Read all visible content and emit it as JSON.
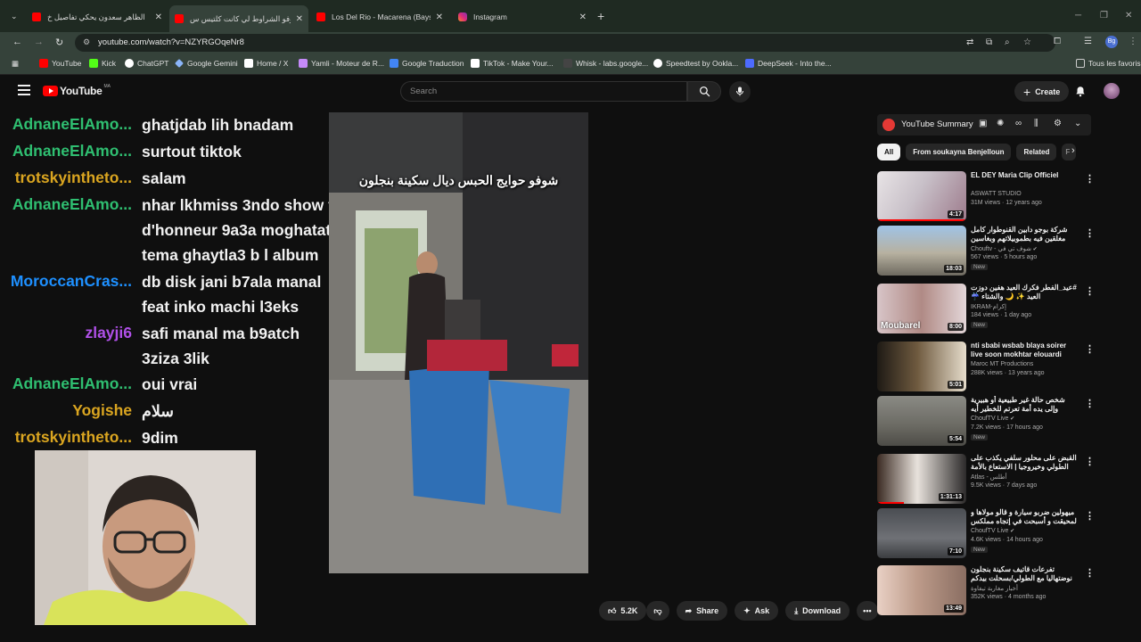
{
  "browser": {
    "tabs": [
      {
        "title": "الظاهر سعدون يحكي تفاصيل خ",
        "icon": "youtube-favicon"
      },
      {
        "title": "شوفو الشراوط لي كانت كلتيس س",
        "icon": "youtube-favicon"
      },
      {
        "title": "Los Del Rio - Macarena (Baysid",
        "icon": "youtube-favicon"
      },
      {
        "title": "Instagram",
        "icon": "instagram-favicon"
      }
    ],
    "url": "youtube.com/watch?v=NZYRGOqeNr8",
    "profile_initials": "Bg",
    "bookmarks": [
      {
        "label": "YouTube",
        "color": "#ff0000"
      },
      {
        "label": "Kick",
        "color": "#53fc18"
      },
      {
        "label": "ChatGPT",
        "color": "#ffffff"
      },
      {
        "label": "Google Gemini",
        "color": "#8ab4f8"
      },
      {
        "label": "Home / X",
        "color": "#ffffff"
      },
      {
        "label": "Yamli - Moteur de R...",
        "color": "#c58af9"
      },
      {
        "label": "Google Traduction",
        "color": "#4285f4"
      },
      {
        "label": "TikTok - Make Your...",
        "color": "#ffffff"
      },
      {
        "label": "Whisk - labs.google...",
        "color": "#444444"
      },
      {
        "label": "Speedtest by Ookla...",
        "color": "#ffffff"
      },
      {
        "label": "DeepSeek - Into the...",
        "color": "#4d6bfe"
      }
    ],
    "all_bookmarks_label": "Tous les favoris"
  },
  "youtube": {
    "logo_text": "YouTube",
    "logo_country": "MA",
    "search_placeholder": "Search",
    "create_label": "Create"
  },
  "chat": [
    {
      "user": "AdnaneElAmo...",
      "color": "#2fbf71",
      "text": "ghatjdab lih bnadam"
    },
    {
      "user": "AdnaneElAmo...",
      "color": "#2fbf71",
      "text": "surtout tiktok"
    },
    {
      "user": "trotskyintheto...",
      "color": "#daa520",
      "text": "salam"
    },
    {
      "user": "AdnaneElAmo...",
      "color": "#2fbf71",
      "text": "nhar lkhmiss 3ndo show f d'honneur 9a3a moghatat tema ghaytla3 b l album"
    },
    {
      "user": "MoroccanCras...",
      "color": "#1e90ff",
      "text": "db disk jani b7ala manal feat inko machi l3eks"
    },
    {
      "user": "zlayji6",
      "color": "#b050e8",
      "text": "safi manal ma b9atch 3ziza 3lik"
    },
    {
      "user": "AdnaneElAmo...",
      "color": "#2fbf71",
      "text": "oui vrai"
    },
    {
      "user": "Yogishe",
      "color": "#daa520",
      "text": "سلام"
    },
    {
      "user": "trotskyintheto...",
      "color": "#daa520",
      "text": "9dim"
    }
  ],
  "video": {
    "caption": "شوفو حوايج الحبس ديال سكينة بنجلون"
  },
  "actions": {
    "likes": "5.2K",
    "share": "Share",
    "ask": "Ask",
    "download": "Download"
  },
  "sidebar": {
    "summary_label": "YouTube Summary",
    "chips": [
      "All",
      "From soukayna Benjelloun",
      "Related",
      "F"
    ],
    "videos": [
      {
        "title": "EL DEY Maria Clip Officiel",
        "channel": "ASWATT STUDIO",
        "meta": "31M views · 12 years ago",
        "duration": "4:17",
        "new": "",
        "verified": false,
        "progress": 1.0
      },
      {
        "title": "شركة بوجو دابين القنوطوار كامل مغلقين فيه بطموبيلاتهم وبغاسين الطريق على",
        "channel": "Chouftv - شوف تي في",
        "meta": "567 views · 5 hours ago",
        "duration": "18:03",
        "new": "New",
        "verified": true,
        "progress": 0
      },
      {
        "title": "#عيد_الفطر فكرك العيد هفين دوزت العيد ✨ 🌙 والشتاء ☔ #عربية_الشلينة في",
        "channel": "IKRAM-إكرام",
        "meta": "184 views · 1 day ago",
        "duration": "8:00",
        "new": "New",
        "verified": false,
        "progress": 0
      },
      {
        "title": "nti sbabi wsbab blaya soirer live soon mokhtar elouardi band ...",
        "channel": "Maroc MT Productions",
        "meta": "288K views · 13 years ago",
        "duration": "5:01",
        "new": "",
        "verified": false,
        "progress": 0
      },
      {
        "title": "شخص حالة غير طبيعية أو هبيرية وإلى يده أمة تعرتم للخطير أيه محصومة ديال الحشيه",
        "channel": "ChoufTV Live",
        "meta": "7.2K views · 17 hours ago",
        "duration": "5:54",
        "new": "New",
        "verified": true,
        "progress": 0
      },
      {
        "title": "القبض على محلور سلفي يكذب على الطولي وخيروجيا | الاستعاع بالأمة السميرة",
        "channel": "Atlas - أطلس",
        "meta": "9.5K views · 7 days ago",
        "duration": "1:31:13",
        "new": "",
        "verified": false,
        "progress": 0.3
      },
      {
        "title": "ميهولين ضربو سيارة و قالو مولاها و لمحيقت و أسبحت في إتجاه مملكس و كافت",
        "channel": "ChoufTV Live",
        "meta": "4.6K views · 14 hours ago",
        "duration": "7:10",
        "new": "New",
        "verified": true,
        "progress": 0
      },
      {
        "title": "تفرعات قاتيف سكينة بنجلون نوضتهاليا مع الطولي/بسحلت بيدكم 😱 جولة نتهي",
        "channel": "أخبار مغاربة تيفاوة",
        "meta": "352K views · 4 months ago",
        "duration": "13:49",
        "new": "",
        "verified": false,
        "progress": 0
      }
    ]
  }
}
